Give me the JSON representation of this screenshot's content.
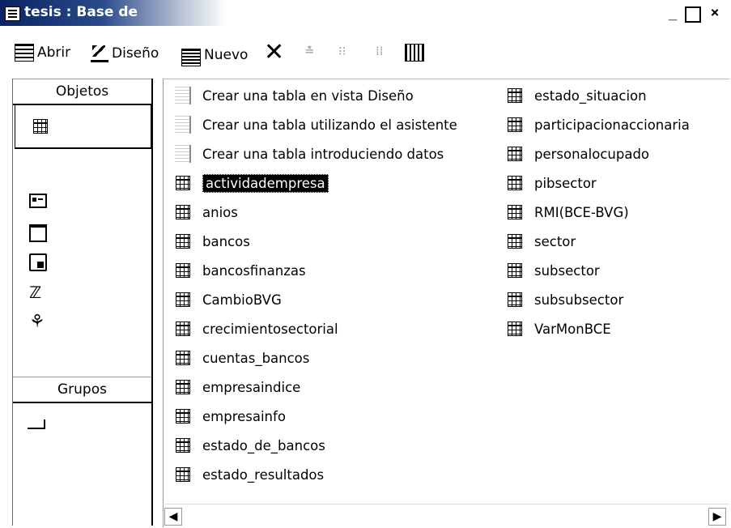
{
  "window": {
    "title": "tesis : Base de",
    "min_label": "_",
    "close_label": "×"
  },
  "toolbar": {
    "open_label": "Abrir",
    "design_label": "Diseño",
    "new_label": "Nuevo",
    "delete_label": "✕",
    "icon_small_label": "≛",
    "icon_list_label": "⁝⁝"
  },
  "objects_bar": {
    "objects_header": "Objetos",
    "groups_header": "Grupos",
    "items": [
      {
        "name": "tables-icon"
      },
      {
        "name": "forms-icon"
      },
      {
        "name": "reports-icon"
      },
      {
        "name": "pages-icon"
      },
      {
        "name": "macros-icon"
      },
      {
        "name": "modules-icon"
      }
    ]
  },
  "list": {
    "shortcuts": [
      "Crear una tabla en vista Diseño",
      "Crear una tabla utilizando el asistente",
      "Crear una tabla introduciendo datos"
    ],
    "column1": [
      "actividadempresa",
      "anios",
      "bancos",
      "bancosfinanzas",
      "CambioBVG",
      "crecimientosectorial",
      "cuentas_bancos",
      "empresaindice",
      "empresainfo",
      "estado_de_bancos",
      "estado_resultados"
    ],
    "column2": [
      "estado_situacion",
      "participacionaccionaria",
      "personalocupado",
      "pibsector",
      "RMI(BCE-BVG)",
      "sector",
      "subsector",
      "subsubsector",
      "VarMonBCE"
    ],
    "selected": "actividadempresa"
  }
}
